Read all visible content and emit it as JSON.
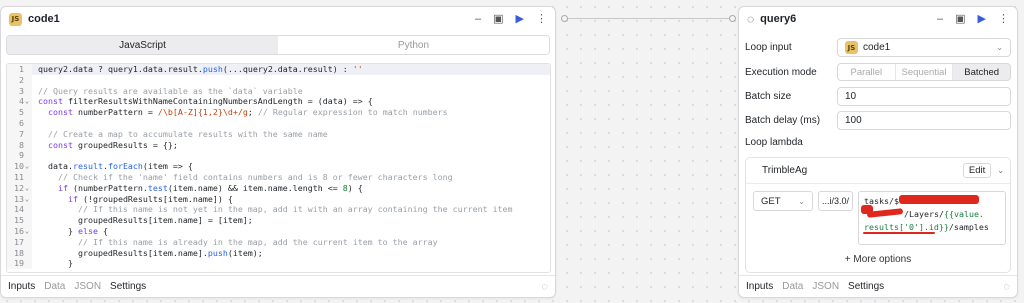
{
  "left": {
    "title": "code1",
    "badge": "JS",
    "tabs": [
      "JavaScript",
      "Python"
    ],
    "code_lines": [
      {
        "n": "1",
        "fold": "",
        "html": "<span class='v'>query2.data</span> ? <span class='v'>query1.data.result.</span><span class='f'>push</span>(...<span class='v'>query2.data.result</span>) : <span class='s'>''</span>"
      },
      {
        "n": "2",
        "fold": "",
        "html": ""
      },
      {
        "n": "3",
        "fold": "",
        "html": "<span class='c'>// Query results are available as the `data` variable</span>"
      },
      {
        "n": "4",
        "fold": "⌄",
        "html": "<span class='k'>const</span> <span class='v'>filterResultsWithNameContainingNumbersAndLength</span> = (data) => {"
      },
      {
        "n": "5",
        "fold": "",
        "html": "  <span class='k'>const</span> <span class='v'>numberPattern</span> = <span class='s'>/\\b[A-Z]{1,2}\\d+/g</span>; <span class='c'>// Regular expression to match numbers</span>"
      },
      {
        "n": "6",
        "fold": "",
        "html": ""
      },
      {
        "n": "7",
        "fold": "",
        "html": "  <span class='c'>// Create a map to accumulate results with the same name</span>"
      },
      {
        "n": "8",
        "fold": "",
        "html": "  <span class='k'>const</span> <span class='v'>groupedResults</span> = {};"
      },
      {
        "n": "9",
        "fold": "",
        "html": ""
      },
      {
        "n": "10",
        "fold": "⌄",
        "html": "  data.<span class='p'>result</span>.<span class='f'>forEach</span>(item => {"
      },
      {
        "n": "11",
        "fold": "",
        "html": "    <span class='c'>// Check if the 'name' field contains numbers and is 8 or fewer characters long</span>"
      },
      {
        "n": "12",
        "fold": "⌄",
        "html": "    <span class='k'>if</span> (numberPattern.<span class='f'>test</span>(item.name) && item.name.length <= <span class='n'>8</span>) {"
      },
      {
        "n": "13",
        "fold": "⌄",
        "html": "      <span class='k'>if</span> (!groupedResults[item.name]) {"
      },
      {
        "n": "14",
        "fold": "",
        "html": "        <span class='c'>// If this name is not yet in the map, add it with an array containing the current item</span>"
      },
      {
        "n": "15",
        "fold": "",
        "html": "        groupedResults[item.name] = [item];"
      },
      {
        "n": "16",
        "fold": "⌄",
        "html": "      } <span class='k'>else</span> {"
      },
      {
        "n": "17",
        "fold": "",
        "html": "        <span class='c'>// If this name is already in the map, add the current item to the array</span>"
      },
      {
        "n": "18",
        "fold": "",
        "html": "        groupedResults[item.name].<span class='f'>push</span>(item);"
      },
      {
        "n": "19",
        "fold": "",
        "html": "      }"
      }
    ],
    "footer_tabs": [
      "Inputs",
      "Data",
      "JSON",
      "Settings"
    ]
  },
  "right": {
    "title": "query6",
    "loop_input_label": "Loop input",
    "loop_input_value": "code1",
    "loop_input_badge": "JS",
    "execution_mode_label": "Execution mode",
    "execution_modes": [
      "Parallel",
      "Sequential",
      "Batched"
    ],
    "batch_size_label": "Batch size",
    "batch_size_value": "10",
    "batch_delay_label": "Batch delay (ms)",
    "batch_delay_value": "100",
    "loop_lambda_label": "Loop lambda",
    "resource_name": "TrimbleAg",
    "edit_label": "Edit",
    "method": "GET",
    "base_url": "...i/3.0/",
    "url_line1": "tasks/$",
    "url_line2": "/Layers/",
    "url_tpl_a": "{{value.",
    "url_tpl_b": "results['0'].id}}",
    "url_tail": "/samples",
    "more_options": "+ More options",
    "footer_tabs": [
      "Inputs",
      "Data",
      "JSON",
      "Settings"
    ]
  }
}
